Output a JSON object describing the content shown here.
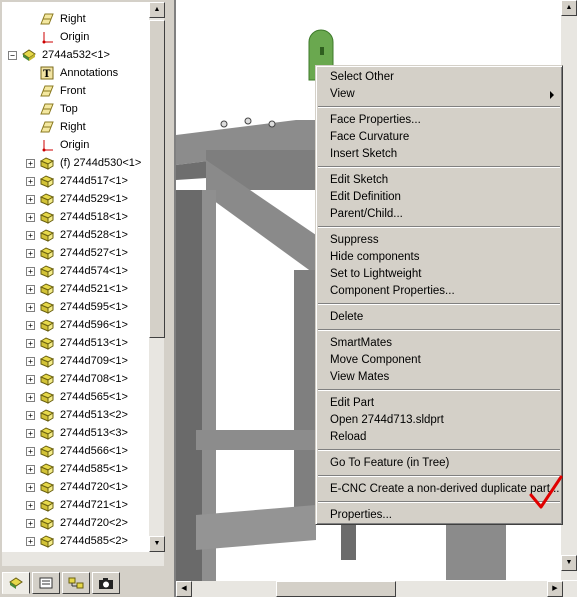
{
  "tree": {
    "rows": [
      {
        "label": "Right",
        "icon": "plane-icon",
        "indent": 1,
        "expander": ""
      },
      {
        "label": "Origin",
        "icon": "origin-icon",
        "indent": 1,
        "expander": ""
      },
      {
        "label": "2744a532<1>",
        "icon": "assembly-icon",
        "indent": 0,
        "expander": "−"
      },
      {
        "label": "Annotations",
        "icon": "annotations-icon",
        "indent": 1,
        "expander": ""
      },
      {
        "label": "Front",
        "icon": "plane-icon",
        "indent": 1,
        "expander": ""
      },
      {
        "label": "Top",
        "icon": "plane-icon",
        "indent": 1,
        "expander": ""
      },
      {
        "label": "Right",
        "icon": "plane-icon",
        "indent": 1,
        "expander": ""
      },
      {
        "label": "Origin",
        "icon": "origin-icon",
        "indent": 1,
        "expander": ""
      },
      {
        "label": "(f) 2744d530<1>",
        "icon": "part-icon",
        "indent": 1,
        "expander": "+"
      },
      {
        "label": "2744d517<1>",
        "icon": "part-icon",
        "indent": 1,
        "expander": "+"
      },
      {
        "label": "2744d529<1>",
        "icon": "part-icon",
        "indent": 1,
        "expander": "+"
      },
      {
        "label": "2744d518<1>",
        "icon": "part-icon",
        "indent": 1,
        "expander": "+"
      },
      {
        "label": "2744d528<1>",
        "icon": "part-icon",
        "indent": 1,
        "expander": "+"
      },
      {
        "label": "2744d527<1>",
        "icon": "part-icon",
        "indent": 1,
        "expander": "+"
      },
      {
        "label": "2744d574<1>",
        "icon": "part-icon",
        "indent": 1,
        "expander": "+"
      },
      {
        "label": "2744d521<1>",
        "icon": "part-icon",
        "indent": 1,
        "expander": "+"
      },
      {
        "label": "2744d595<1>",
        "icon": "part-icon",
        "indent": 1,
        "expander": "+"
      },
      {
        "label": "2744d596<1>",
        "icon": "part-icon",
        "indent": 1,
        "expander": "+"
      },
      {
        "label": "2744d513<1>",
        "icon": "part-icon",
        "indent": 1,
        "expander": "+"
      },
      {
        "label": "2744d709<1>",
        "icon": "part-icon",
        "indent": 1,
        "expander": "+"
      },
      {
        "label": "2744d708<1>",
        "icon": "part-icon",
        "indent": 1,
        "expander": "+"
      },
      {
        "label": "2744d565<1>",
        "icon": "part-icon",
        "indent": 1,
        "expander": "+"
      },
      {
        "label": "2744d513<2>",
        "icon": "part-icon",
        "indent": 1,
        "expander": "+"
      },
      {
        "label": "2744d513<3>",
        "icon": "part-icon",
        "indent": 1,
        "expander": "+"
      },
      {
        "label": "2744d566<1>",
        "icon": "part-icon",
        "indent": 1,
        "expander": "+"
      },
      {
        "label": "2744d585<1>",
        "icon": "part-icon",
        "indent": 1,
        "expander": "+"
      },
      {
        "label": "2744d720<1>",
        "icon": "part-icon",
        "indent": 1,
        "expander": "+"
      },
      {
        "label": "2744d721<1>",
        "icon": "part-icon",
        "indent": 1,
        "expander": "+"
      },
      {
        "label": "2744d720<2>",
        "icon": "part-icon",
        "indent": 1,
        "expander": "+"
      },
      {
        "label": "2744d585<2>",
        "icon": "part-icon",
        "indent": 1,
        "expander": "+"
      }
    ]
  },
  "tabs": [
    {
      "icon": "feature-manager-icon"
    },
    {
      "icon": "property-manager-icon"
    },
    {
      "icon": "configuration-manager-icon"
    },
    {
      "icon": "camera-icon"
    }
  ],
  "context_menu": {
    "items": [
      {
        "label": "Select Other",
        "submenu": false
      },
      {
        "label": "View",
        "submenu": true
      },
      {
        "sep": true
      },
      {
        "label": "Face Properties...",
        "submenu": false
      },
      {
        "label": "Face Curvature",
        "submenu": false
      },
      {
        "label": "Insert Sketch",
        "submenu": false
      },
      {
        "sep": true
      },
      {
        "label": "Edit Sketch",
        "submenu": false
      },
      {
        "label": "Edit Definition",
        "submenu": false
      },
      {
        "label": "Parent/Child...",
        "submenu": false
      },
      {
        "sep": true
      },
      {
        "label": "Suppress",
        "submenu": false
      },
      {
        "label": "Hide components",
        "submenu": false
      },
      {
        "label": "Set to Lightweight",
        "submenu": false
      },
      {
        "label": "Component Properties...",
        "submenu": false
      },
      {
        "sep": true
      },
      {
        "label": "Delete",
        "submenu": false
      },
      {
        "sep": true
      },
      {
        "label": "SmartMates",
        "submenu": false
      },
      {
        "label": "Move Component",
        "submenu": false
      },
      {
        "label": "View Mates",
        "submenu": false
      },
      {
        "sep": true
      },
      {
        "label": "Edit Part",
        "submenu": false
      },
      {
        "label": "Open 2744d713.sldprt",
        "submenu": false
      },
      {
        "label": "Reload",
        "submenu": false
      },
      {
        "sep": true
      },
      {
        "label": "Go To Feature (in Tree)",
        "submenu": false
      },
      {
        "sep": true
      },
      {
        "label": "E-CNC Create a non-derived duplicate part...",
        "submenu": false
      },
      {
        "sep": true
      },
      {
        "label": "Properties...",
        "submenu": false
      }
    ]
  },
  "colors": {
    "checkmark": "#e00000",
    "highlight_part": "#6aa84f",
    "steel": "#9a9a9a"
  }
}
